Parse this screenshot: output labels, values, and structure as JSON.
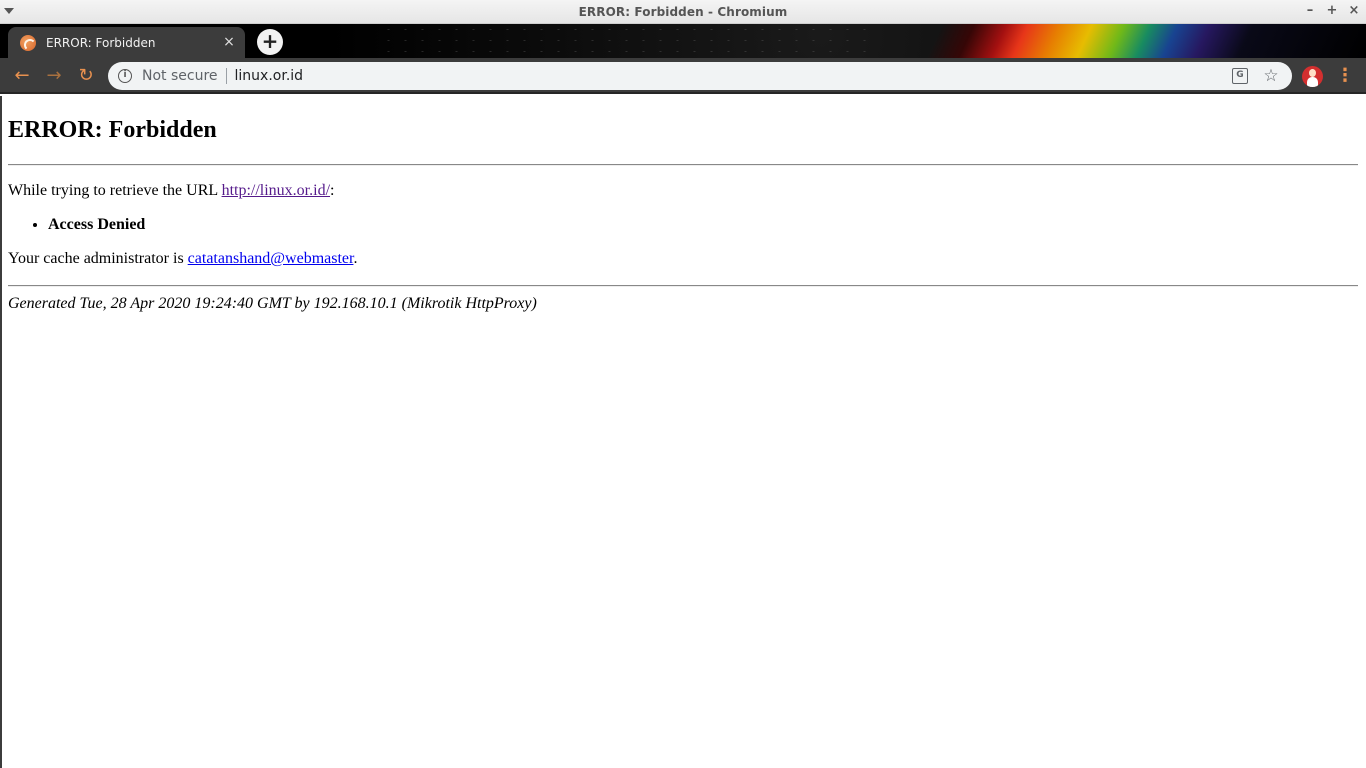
{
  "window": {
    "title": "ERROR: Forbidden - Chromium",
    "controls": {
      "minimize": "–",
      "maximize": "+",
      "close": "×"
    }
  },
  "tab": {
    "title": "ERROR: Forbidden",
    "close": "×",
    "new_tab": "+"
  },
  "toolbar": {
    "back": "←",
    "forward": "→",
    "reload": "↻",
    "info_glyph": "i",
    "security_label": "Not secure",
    "url": "linux.or.id",
    "translate_glyph": "G",
    "star_glyph": "☆",
    "menu_glyph": "⋮"
  },
  "page": {
    "heading": "ERROR: Forbidden",
    "retrieve_prefix": "While trying to retrieve the URL ",
    "retrieve_url": "http://linux.or.id/",
    "retrieve_suffix": ":",
    "error_item": "Access Denied",
    "admin_prefix": "Your cache administrator is ",
    "admin_email": "catatanshand@webmaster",
    "admin_suffix": ".",
    "generated": "Generated Tue, 28 Apr 2020 19:24:40 GMT by 192.168.10.1 (Mikrotik HttpProxy)"
  },
  "colors": {
    "toolbar_bg": "#3c3c3c",
    "accent_orange": "#e8914f",
    "link_visited": "#551a8b",
    "link": "#0000ee"
  }
}
